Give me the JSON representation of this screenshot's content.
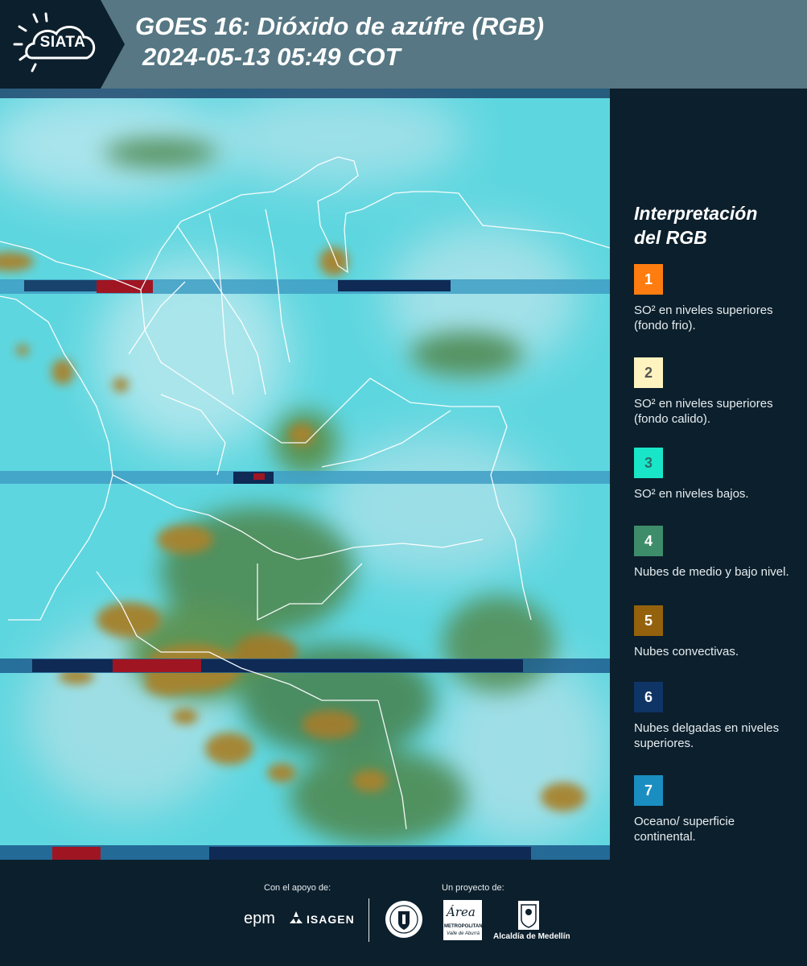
{
  "header": {
    "logo_text": "SIATA",
    "title_line1": "GOES 16: Dióxido de azúfre (RGB)",
    "title_line2": "2024-05-13 05:49 COT"
  },
  "legend": {
    "title_line1": "Interpretación",
    "title_line2": "del RGB",
    "items": [
      {
        "number": "1",
        "color": "#ff7d10",
        "text_color": "#ffffff",
        "description": "SO² en niveles superiores (fondo frio)."
      },
      {
        "number": "2",
        "color": "#fff4c0",
        "text_color": "#555555",
        "description": "SO² en niveles superiores (fondo calido)."
      },
      {
        "number": "3",
        "color": "#19e6c8",
        "text_color": "#2c6e69",
        "description": "SO² en niveles bajos."
      },
      {
        "number": "4",
        "color": "#3d8d6a",
        "text_color": "#ffffff",
        "description": "Nubes de medio y bajo nivel."
      },
      {
        "number": "5",
        "color": "#94620c",
        "text_color": "#ffffff",
        "description": "Nubes convectivas."
      },
      {
        "number": "6",
        "color": "#0e3566",
        "text_color": "#ffffff",
        "description": "Nubes delgadas en niveles superiores."
      },
      {
        "number": "7",
        "color": "#1a8ec0",
        "text_color": "#ffffff",
        "description": "Oceano/ superficie continental."
      }
    ]
  },
  "footer": {
    "support_label": "Con el apoyo de:",
    "project_label": "Un proyecto de:",
    "sponsor1": "epm",
    "sponsor2": "ISAGEN",
    "partner_area": "Área",
    "partner_area_sub1": "METROPOLITANA",
    "partner_area_sub2": "Valle de Aburrá",
    "partner_alcaldia": "Alcaldía de Medellín"
  },
  "colors": {
    "header_bg": "#567783",
    "page_bg": "#0c1f2c",
    "map_base": "#5ed6df",
    "haze": "#b6e6ee",
    "cloud_green": "#4f8a52",
    "cloud_brown": "#a7832e",
    "stripe_red": "#a01522",
    "stripe_navy": "#0e2a55"
  }
}
